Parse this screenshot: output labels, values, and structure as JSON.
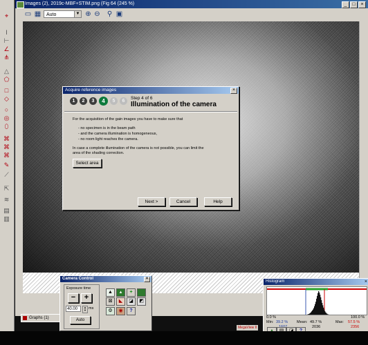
{
  "image_window": {
    "title": "Images (2), 2019c-MBF+STIM.png (Fig 64 (245 %)",
    "zoom": "Auto",
    "buttons": [
      "_",
      "□",
      "×"
    ]
  },
  "icons": {
    "toolbar": [
      "browse-icon",
      "grid-icon",
      "zoom-in-icon",
      "zoom-out-icon",
      "zoom-fit-icon",
      "image-icon"
    ],
    "tools": [
      "pointer-icon",
      "text-icon",
      "line-icon",
      "angle-icon",
      "profile-icon",
      "triangle-icon",
      "polygon-icon",
      "rect-icon",
      "diamond-icon",
      "circle-icon",
      "ring-icon",
      "ellipse-icon",
      "scale-icon",
      "magic-icon",
      "ruler-icon",
      "pen-icon",
      "wand-icon",
      "arrow-icon",
      "stack-icon",
      "notes-icon",
      "list-icon"
    ]
  },
  "dialog": {
    "title": "Acquire reference images",
    "close": "×",
    "steps": [
      "1",
      "2",
      "3",
      "4",
      "5",
      "6"
    ],
    "active_step": 4,
    "step_label": "Step 4 of 6",
    "heading": "Illumination of the camera",
    "intro": "For the acquisition of the gain images you have to make sure that",
    "bullets": [
      "- no specimen is in the beam path",
      "- and the camera illumination is homogeneous,",
      "- no room light reaches the camera."
    ],
    "note_line1": "In case a complete illumination of the camera is not possible, you can limit the",
    "note_line2": "area of the shading correction.",
    "select_area": "Select area",
    "next": "Next >",
    "cancel": "Cancel",
    "help": "Help"
  },
  "camera": {
    "title": "Camera Control",
    "close": "×",
    "exposure_label": "Exposure time",
    "minus": "−",
    "plus": "+",
    "value": "40.00",
    "unit": "ms",
    "auto": "Auto",
    "help": "?"
  },
  "graphs": {
    "label": "Graphs (1)"
  },
  "histogram": {
    "title": "Histogram",
    "close": "×",
    "left_pct": "0.0 %",
    "right_pct": "100.0 %",
    "min_label": "Min:",
    "min_pct": "39.2 %",
    "min_val": "1607",
    "mean_label": "Mean:",
    "mean_pct": "49.7 %",
    "mean_val": "2036",
    "max_label": "Max:",
    "max_pct": "57.5 %",
    "max_val": "2356",
    "help": "?",
    "series": [
      0,
      0,
      0,
      0,
      0,
      0,
      0,
      0,
      0,
      0,
      0,
      0,
      0,
      0,
      0,
      0,
      0,
      0,
      0,
      0,
      0,
      0,
      0,
      0,
      0,
      0,
      0,
      0,
      0,
      0,
      0,
      0,
      0,
      0,
      0,
      0,
      0,
      0,
      0,
      0,
      0,
      0,
      0,
      0,
      0,
      0,
      0,
      0,
      0,
      0,
      0,
      0,
      0,
      0,
      0,
      0,
      0,
      0,
      1,
      2,
      3,
      5,
      7,
      10,
      14,
      18,
      22,
      28,
      36,
      45,
      55,
      68,
      80,
      92,
      100,
      94,
      85,
      74,
      62,
      50,
      40,
      30,
      22,
      15,
      10,
      7,
      4,
      2,
      1,
      0,
      0,
      0,
      0,
      0,
      0,
      0,
      0,
      0,
      0,
      0,
      0,
      0,
      0,
      0,
      0,
      0,
      0,
      0,
      0,
      0,
      0,
      0,
      0,
      0,
      0,
      0,
      0,
      0,
      0,
      0,
      0,
      0,
      0,
      0,
      0,
      0,
      0,
      0,
      0,
      0,
      0,
      0,
      0,
      0,
      0,
      0,
      0,
      0,
      0,
      0,
      0,
      0,
      0,
      0
    ]
  },
  "megaview": "MegaView II",
  "colors": {
    "title_bar": "#0a246a",
    "step_active": "#0d7a3c",
    "step_done": "#3c3c3c",
    "step_future": "#bdbdbd",
    "tool_red": "#b00010",
    "hist_green": "#2aa02a",
    "hist_red": "#cc0000"
  }
}
